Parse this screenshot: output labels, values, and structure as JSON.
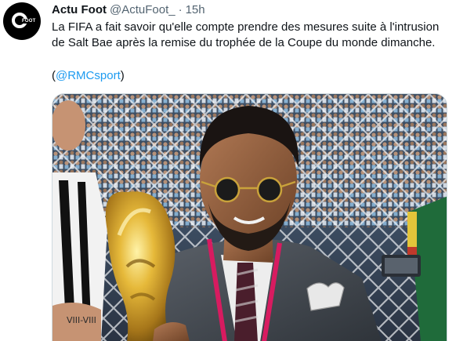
{
  "tweet": {
    "author": {
      "display_name": "Actu Foot",
      "handle": "@ActuFoot_",
      "avatar_text": "FOOT"
    },
    "separator": "·",
    "time": "15h",
    "text_line_1": "La FIFA a fait savoir qu'elle compte prendre des mesures suite à l'intrusion",
    "text_line_2": "de Salt Bae après la remise du trophée de la Coupe du monde dimanche.",
    "mention_open": "(",
    "mention_link": "@RMCsport",
    "mention_close": ")",
    "media": {
      "jersey_lettering": "VIII-VIII"
    }
  }
}
